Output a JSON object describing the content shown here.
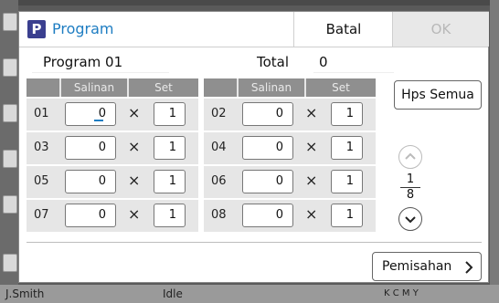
{
  "background": {
    "user": "J.Smith",
    "status": "Idle",
    "toner": "K C M Y"
  },
  "dialog": {
    "title_icon": "P",
    "title": "Program",
    "cancel_label": "Batal",
    "ok_label": "OK"
  },
  "program": {
    "name": "Program 01",
    "total_label": "Total",
    "total_value": "0"
  },
  "table": {
    "header_copies": "Salinan",
    "header_set": "Set",
    "multiply_sign": "×",
    "rows": [
      {
        "num": "01",
        "copies": "0",
        "set": "1"
      },
      {
        "num": "02",
        "copies": "0",
        "set": "1"
      },
      {
        "num": "03",
        "copies": "0",
        "set": "1"
      },
      {
        "num": "04",
        "copies": "0",
        "set": "1"
      },
      {
        "num": "05",
        "copies": "0",
        "set": "1"
      },
      {
        "num": "06",
        "copies": "0",
        "set": "1"
      },
      {
        "num": "07",
        "copies": "0",
        "set": "1"
      },
      {
        "num": "08",
        "copies": "0",
        "set": "1"
      }
    ]
  },
  "actions": {
    "clear_all_label": "Hps Semua",
    "separation_label": "Pemisahan"
  },
  "pager": {
    "current": "1",
    "total": "8"
  },
  "icons": {
    "scroll_up": "chevron-up-icon",
    "scroll_down": "chevron-down-icon",
    "next": "chevron-right-icon"
  },
  "colors": {
    "accent": "#1e7dc2",
    "header_bg": "#8f8f8f"
  }
}
